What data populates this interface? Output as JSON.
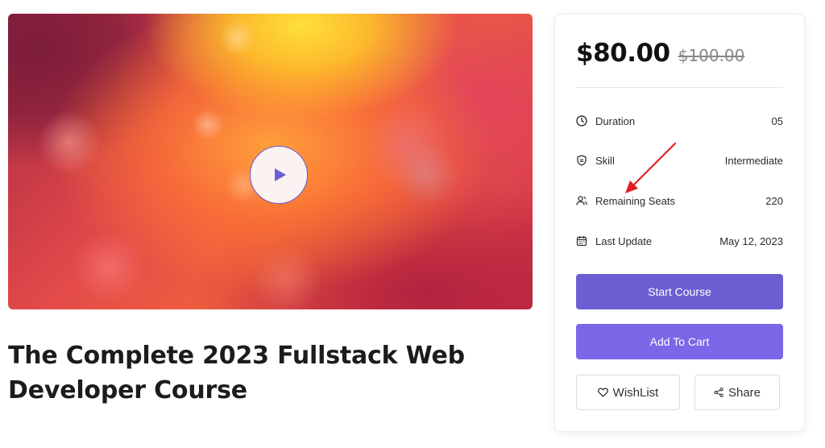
{
  "course": {
    "title_line1": "The Complete 2023 Fullstack Web",
    "title_line2": "Developer Course"
  },
  "pricing": {
    "price": "$80.00",
    "original_price": "$100.00"
  },
  "details": [
    {
      "icon": "clock-icon",
      "label": "Duration",
      "value": "05"
    },
    {
      "icon": "shield-icon",
      "label": "Skill",
      "value": "Intermediate"
    },
    {
      "icon": "users-icon",
      "label": "Remaining Seats",
      "value": "220"
    },
    {
      "icon": "calendar-icon",
      "label": "Last Update",
      "value": "May 12, 2023"
    }
  ],
  "actions": {
    "start_label": "Start Course",
    "cart_label": "Add To Cart",
    "wishlist_label": "WishList",
    "share_label": "Share"
  },
  "colors": {
    "primary": "#6c5ed3",
    "primary_light": "#7b67e8",
    "annotation_arrow": "#e02020"
  }
}
